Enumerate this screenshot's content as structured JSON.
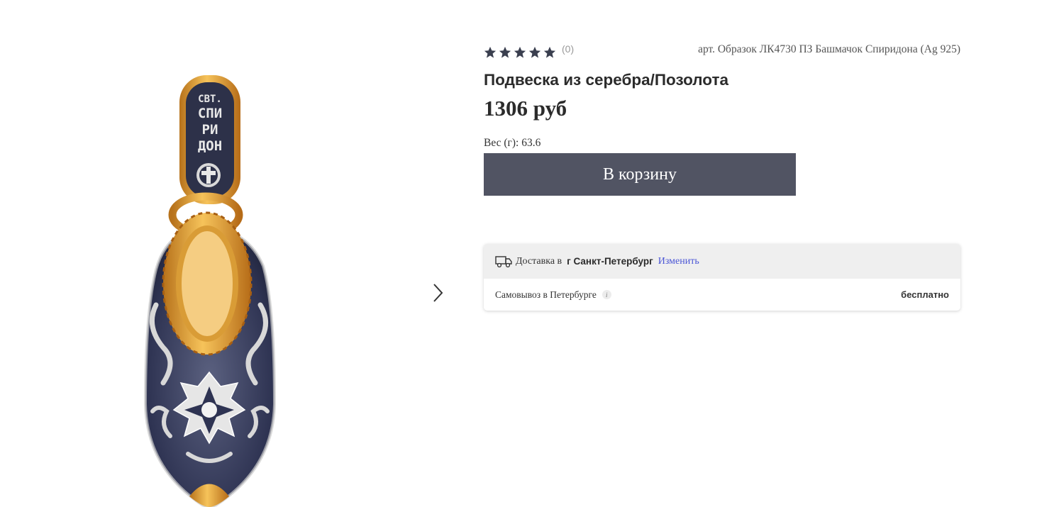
{
  "product": {
    "rating_count": "(0)",
    "stars": 5,
    "article": "арт. Образок ЛК4730 ПЗ Башмачок Спиридона (Ag 925)",
    "title": "Подвеска из серебра/Позолота",
    "price": "1306 руб",
    "weight": "Вес (г): 63.6",
    "cart_button": "В корзину",
    "image_icon": "pendant-image",
    "image_text": [
      "СВТ.",
      "СПИ",
      "РИ",
      "ДОН"
    ]
  },
  "delivery": {
    "label": "Доставка в",
    "city": "г Санкт-Петербург",
    "change": "Изменить",
    "pickup": "Самовывоз в Петербурге",
    "info_icon": "i",
    "pickup_price": "бесплатно"
  },
  "colors": {
    "button": "#515463",
    "link": "#4b56d6",
    "star": "#3a3f4f",
    "gold": "#e8a63a",
    "enamel": "#2e3352"
  }
}
